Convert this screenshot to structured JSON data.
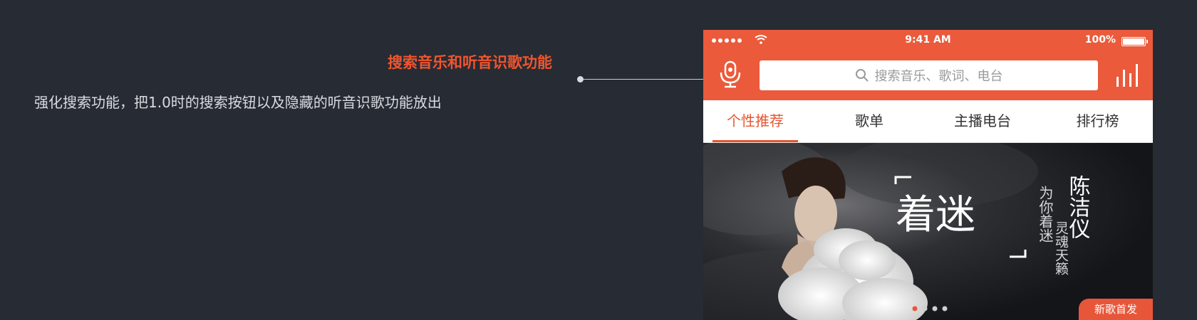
{
  "annotation": {
    "title": "搜索音乐和听音识歌功能",
    "description": "强化搜索功能，把1.0时的搜索按钮以及隐藏的听音识歌功能放出"
  },
  "status_bar": {
    "time": "9:41 AM",
    "battery": "100%"
  },
  "search": {
    "placeholder": "搜索音乐、歌词、电台"
  },
  "tabs": [
    {
      "label": "个性推荐",
      "active": true
    },
    {
      "label": "歌单"
    },
    {
      "label": "主播电台"
    },
    {
      "label": "排行榜"
    }
  ],
  "banner": {
    "album_title": "着迷",
    "subtitle_left": "为你着迷",
    "artist": "陈洁仪",
    "subtitle_right": "灵魂天籁",
    "badge": "新歌首发",
    "carousel": {
      "count": 4,
      "active": 1
    }
  },
  "colors": {
    "background": "#272b33",
    "accent": "#ea5a3b"
  },
  "icons": [
    "wifi-icon",
    "mic-icon",
    "search-icon",
    "equalizer-icon",
    "battery-icon"
  ]
}
